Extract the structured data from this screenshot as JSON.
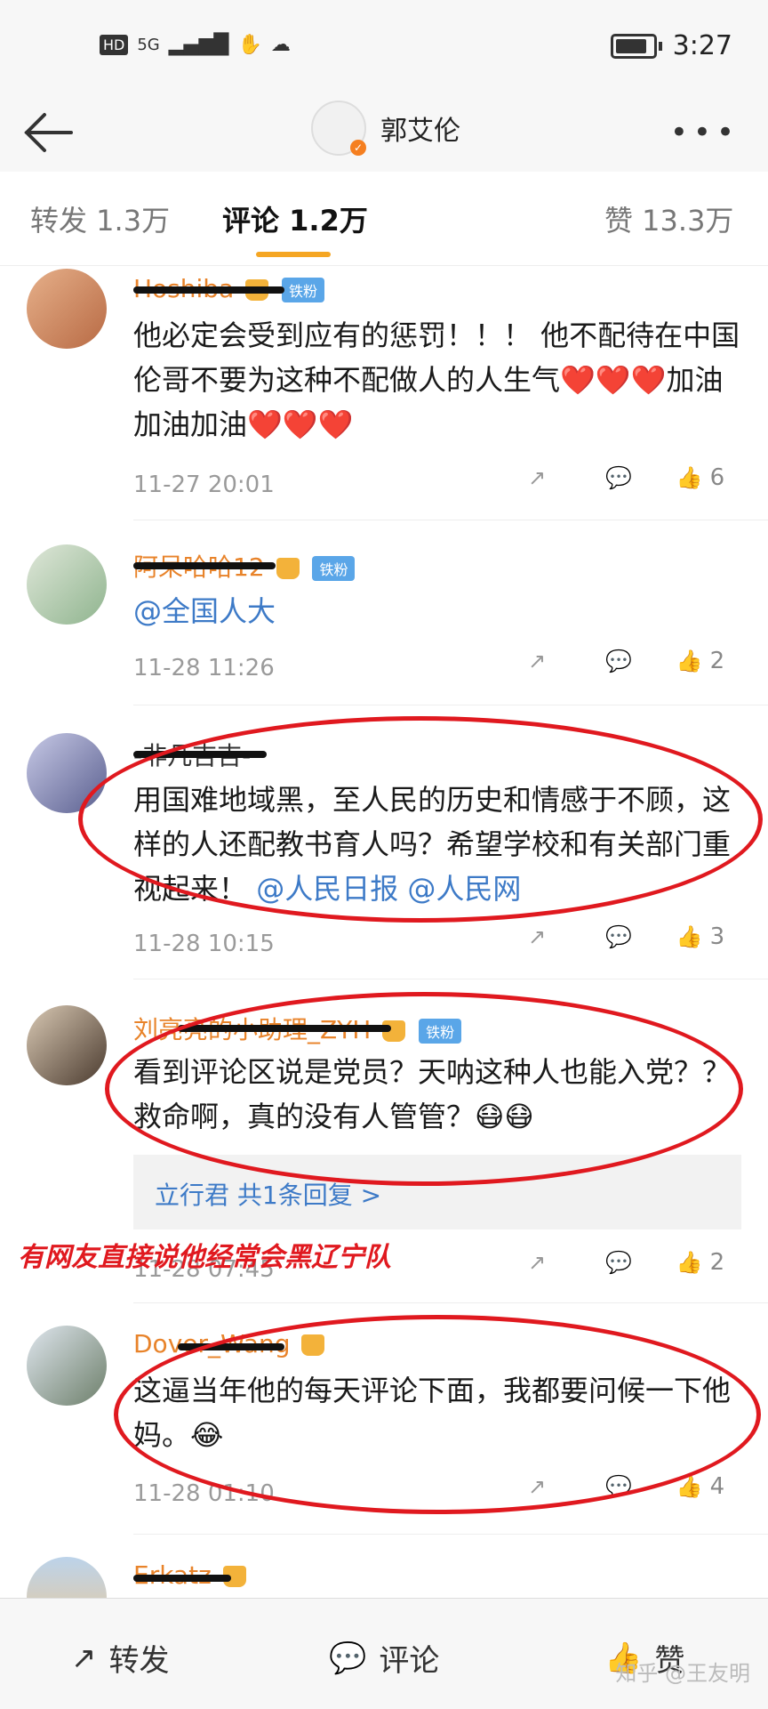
{
  "status_bar": {
    "hd": "HD",
    "net": "5G",
    "time": "3:27"
  },
  "header": {
    "title": "郭艾伦"
  },
  "tabs": [
    {
      "label": "转发 1.3万"
    },
    {
      "label": "评论 1.2万"
    },
    {
      "label": "赞 13.3万"
    }
  ],
  "comments": [
    {
      "username": "Hoshiba",
      "badge": "铁粉",
      "text": "他必定会受到应有的惩罚！！！ 他不配待在中国 伦哥不要为这种不配做人的人生气❤️❤️❤️加油加油加油❤️❤️❤️",
      "time": "11-27 20:01",
      "likes": "6"
    },
    {
      "username": "阿呆哈哈12",
      "badge": "铁粉",
      "text": "@全国人大",
      "time": "11-28 11:26",
      "likes": "2"
    },
    {
      "username": "-非凡吉吉-",
      "text_pre": "用国难地域黑，至人民的历史和情感于不顾，这样的人还配教书育人吗？希望学校和有关部门重视起来！",
      "mention1": "@人民日报",
      "mention2": "@人民网",
      "time": "11-28 10:15",
      "likes": "3"
    },
    {
      "username": "刘亮亮的小助理_ZYH",
      "badge": "铁粉",
      "text": "看到评论区说是党员？天呐这种人也能入党？？救命啊，真的没有人管管？😷😷",
      "reply": "立行君 共1条回复 >",
      "time": "11-28 07:45",
      "likes": "2"
    },
    {
      "username": "Dover_Wang",
      "text": "这逼当年他的每天评论下面，我都要问候一下他妈。😂",
      "time": "11-28 01:10",
      "likes": "4"
    },
    {
      "username": "Erkatz"
    }
  ],
  "annotation": "有网友直接说他经常会黑辽宁队",
  "bottom_bar": {
    "repost": "转发",
    "comment": "评论",
    "like": "赞",
    "watermark": "知乎 @王友明"
  }
}
